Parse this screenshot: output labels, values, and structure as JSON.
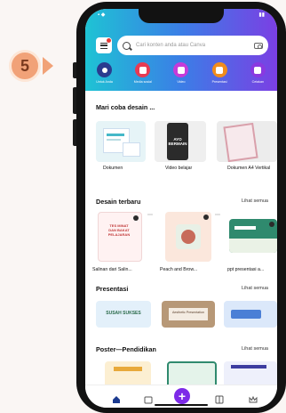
{
  "step": {
    "number": "5"
  },
  "search": {
    "placeholder": "Cari konten anda atau Canva"
  },
  "categories": [
    {
      "label": "Untuk Anda",
      "color": "#2a3b8f"
    },
    {
      "label": "Media sosial",
      "color": "#e83a52"
    },
    {
      "label": "Video",
      "color": "#c53bd9"
    },
    {
      "label": "Presentasi",
      "color": "#f08c1c"
    },
    {
      "label": "Cetakan",
      "color": "#8a39e0"
    }
  ],
  "try_design": {
    "title": "Mari coba desain ...",
    "items": [
      {
        "label": "Dokumen"
      },
      {
        "label": "Video belajar",
        "thumb_text": "AYO BERMAIN"
      },
      {
        "label": "Dokumen A4 Vertikal"
      }
    ]
  },
  "recent": {
    "title": "Desain terbaru",
    "see_all": "Lihat semua",
    "items": [
      {
        "label": "Salinan dari Salin...",
        "thumb_text": "TES MINAT DAN BAKAT PELAJARAN"
      },
      {
        "label": "Peach and Brow..."
      },
      {
        "label": "ppt presentasi a..."
      }
    ]
  },
  "presentations": {
    "title": "Presentasi",
    "see_all": "Lihat semua",
    "items": [
      {
        "thumb_text": "SUSAH SUKSES"
      },
      {
        "thumb_text": "Aesthetic Presentation"
      },
      {
        "thumb_text": ""
      }
    ]
  },
  "posters": {
    "title": "Poster—Pendidikan",
    "see_all": "Lihat semua"
  },
  "tabbar": {
    "fab_label": "+"
  }
}
